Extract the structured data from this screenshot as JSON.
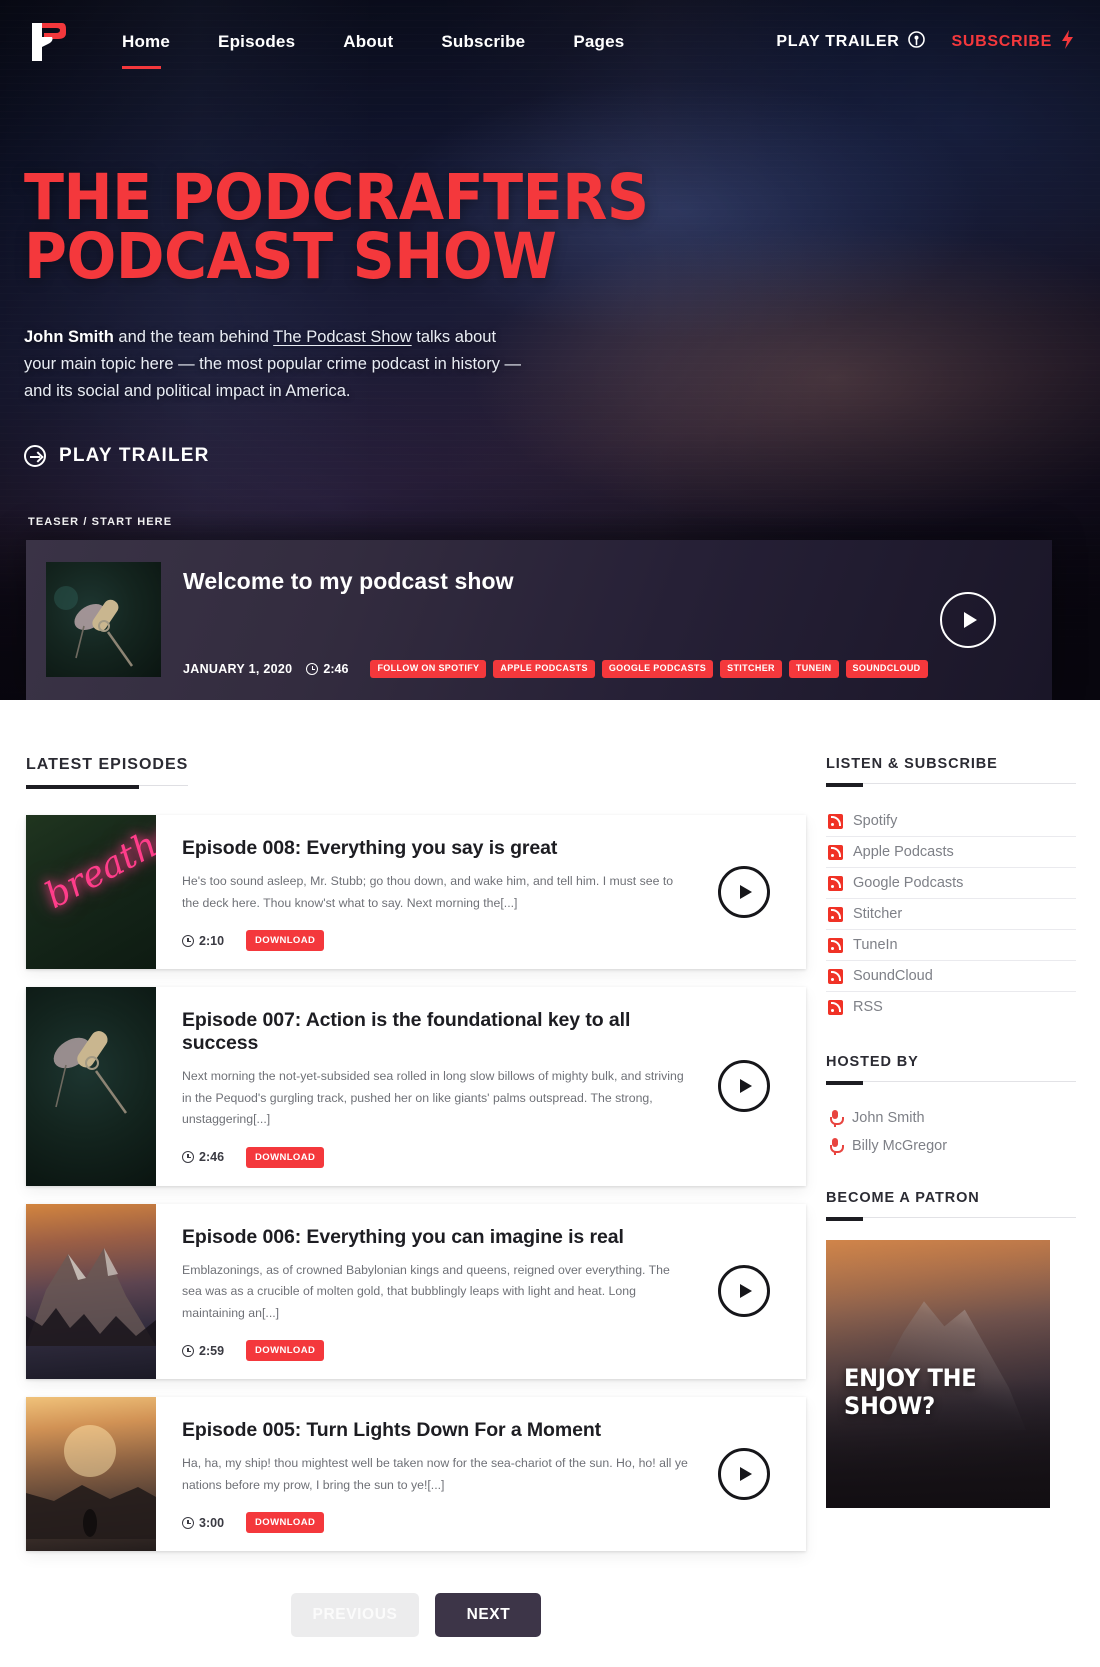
{
  "nav": {
    "logo": "podcrafters-logo",
    "links": [
      {
        "label": "Home",
        "active": true
      },
      {
        "label": "Episodes",
        "active": false
      },
      {
        "label": "About",
        "active": false
      },
      {
        "label": "Subscribe",
        "active": false
      },
      {
        "label": "Pages",
        "active": false
      }
    ],
    "play_trailer": "PLAY TRAILER",
    "subscribe": "SUBSCRIBE"
  },
  "hero": {
    "title_line1": "THE PODCRAFTERS",
    "title_line2": "PODCAST SHOW",
    "sub_bold": "John Smith",
    "sub_mid": " and the team behind ",
    "sub_link": "The Podcast Show",
    "sub_rest": " talks about your main topic here — the most popular crime podcast in history — and its social and political impact in America.",
    "play_trailer": "PLAY TRAILER",
    "accent": "#F4383C"
  },
  "teaser": {
    "label": "TEASER / START HERE",
    "title": "Welcome to my podcast show",
    "date": "JANUARY 1, 2020",
    "duration": "2:46",
    "badges": [
      "FOLLOW ON SPOTIFY",
      "APPLE PODCASTS",
      "GOOGLE PODCASTS",
      "STITCHER",
      "TUNEIN",
      "SOUNDCLOUD"
    ]
  },
  "main": {
    "heading": "LATEST EPISODES",
    "episodes": [
      {
        "title": "Episode 008: Everything you say is great",
        "desc": "He's too sound asleep, Mr. Stubb; go thou down, and wake him, and tell him. I must see to the deck here. Thou know'st what to say. Next morning the[...]",
        "duration": "2:10",
        "download": "DOWNLOAD",
        "thumb": "neon-breathe-sign",
        "thumb_text": "breathe"
      },
      {
        "title": "Episode 007: Action is the foundational key to all success",
        "desc": "Next morning the not-yet-subsided sea rolled in long slow billows of mighty bulk, and striving in the Pequod's gurgling track, pushed her on like giants' palms outspread. The strong, unstaggering[...]",
        "duration": "2:46",
        "download": "DOWNLOAD",
        "thumb": "studio-microphone",
        "thumb_text": ""
      },
      {
        "title": "Episode 006: Everything you can imagine is real",
        "desc": "Emblazonings, as of crowned Babylonian kings and queens, reigned over everything. The sea was as a crucible of molten gold, that bubblingly leaps with light and heat. Long maintaining an[...]",
        "duration": "2:59",
        "download": "DOWNLOAD",
        "thumb": "mountain-sunset",
        "thumb_text": ""
      },
      {
        "title": "Episode 005: Turn Lights Down For a Moment",
        "desc": "Ha, ha, my ship! thou mightest well be taken now for the sea-chariot of the sun. Ho, ho! all ye nations before my prow, I bring the sun to ye![...]",
        "duration": "3:00",
        "download": "DOWNLOAD",
        "thumb": "person-walking-sunset",
        "thumb_text": ""
      }
    ],
    "pager": {
      "previous": "PREVIOUS",
      "next": "NEXT"
    }
  },
  "sidebar": {
    "listen": {
      "heading": "LISTEN & SUBSCRIBE",
      "items": [
        "Spotify",
        "Apple Podcasts",
        "Google Podcasts",
        "Stitcher",
        "TuneIn",
        "SoundCloud",
        "RSS"
      ]
    },
    "hosted": {
      "heading": "HOSTED BY",
      "items": [
        "John Smith",
        "Billy McGregor"
      ]
    },
    "patron": {
      "heading": "BECOME A PATRON",
      "card_text": "ENJOY THE SHOW?"
    }
  }
}
